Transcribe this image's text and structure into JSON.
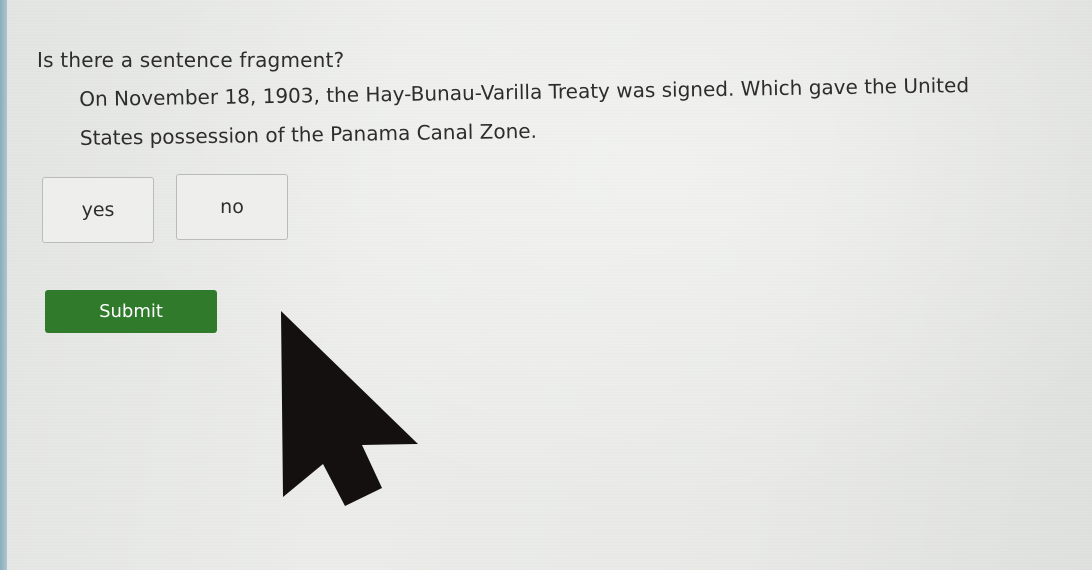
{
  "question": {
    "prompt": "Is there a sentence fragment?",
    "passage_line1": "On November 18, 1903, the Hay-Bunau-Varilla Treaty was signed. Which gave the United",
    "passage_line2": "States possession of the Panama Canal Zone."
  },
  "choices": [
    {
      "label": "yes"
    },
    {
      "label": "no"
    }
  ],
  "submit": {
    "label": "Submit",
    "color": "#307a2b"
  },
  "pointer": {
    "icon": "mouse-pointer-arrow-icon",
    "color": "#151010"
  }
}
